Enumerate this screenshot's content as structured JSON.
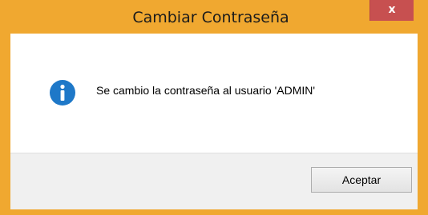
{
  "window": {
    "title": "Cambiar Contraseña",
    "close_label": "x"
  },
  "dialog": {
    "icon": "info-icon",
    "message": "Se cambio la contraseña al usuario 'ADMIN'",
    "ok_label": "Aceptar"
  },
  "colors": {
    "frame": "#f0a830",
    "close_button": "#c75050",
    "icon_fill": "#1e78c8",
    "button_area": "#f0f0f0"
  }
}
